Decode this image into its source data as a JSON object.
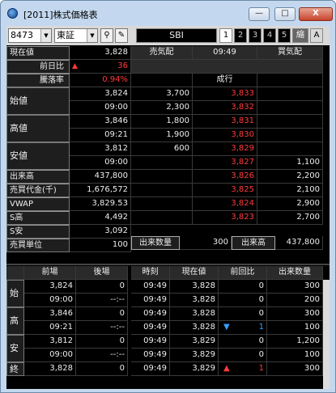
{
  "window": {
    "title": "[2011]株式価格表",
    "minimize": "—",
    "maximize": "□",
    "close": "X"
  },
  "toolbar": {
    "code": "8473",
    "market": "東証",
    "broker": "SBI",
    "tabs": [
      "1",
      "2",
      "3",
      "4",
      "5"
    ],
    "shuku": "縮",
    "a": "A"
  },
  "top_header": {
    "sell": "売気配",
    "time": "09:49",
    "buy": "買気配"
  },
  "left": {
    "genzai": {
      "label": "現在値",
      "value": "3,828"
    },
    "zenjitsu": {
      "label": "前日比",
      "value": "36"
    },
    "toraku": {
      "label": "騰落率",
      "value": "0.94%"
    },
    "hajime": {
      "label": "始値",
      "v1": "3,824",
      "v2": "09:00"
    },
    "takane": {
      "label": "高値",
      "v1": "3,846",
      "v2": "09:21"
    },
    "yasune": {
      "label": "安値",
      "v1": "3,812",
      "v2": "09:00"
    },
    "dekidaka": {
      "label": "出来高",
      "value": "437,800"
    },
    "baibai": {
      "label": "売買代金(千)",
      "value": "1,676,572"
    },
    "vwap": {
      "label": "VWAP",
      "value": "3,829.53"
    },
    "sdaka": {
      "label": "S高",
      "value": "4,492"
    },
    "syasu": {
      "label": "S安",
      "value": "3,092"
    },
    "tani": {
      "label": "売買単位",
      "value": "100"
    }
  },
  "board": [
    {
      "sell": "",
      "price": "成行",
      "buy": ""
    },
    {
      "sell": "3,700",
      "price": "3,833",
      "buy": ""
    },
    {
      "sell": "2,300",
      "price": "3,832",
      "buy": ""
    },
    {
      "sell": "1,800",
      "price": "3,831",
      "buy": ""
    },
    {
      "sell": "1,900",
      "price": "3,830",
      "buy": ""
    },
    {
      "sell": "600",
      "price": "3,829",
      "buy": ""
    },
    {
      "sell": "",
      "price": "3,827",
      "buy": "1,100"
    },
    {
      "sell": "",
      "price": "3,826",
      "buy": "2,200"
    },
    {
      "sell": "",
      "price": "3,825",
      "buy": "2,100"
    },
    {
      "sell": "",
      "price": "3,824",
      "buy": "2,900"
    },
    {
      "sell": "",
      "price": "3,823",
      "buy": "2,700"
    }
  ],
  "volume_row": {
    "label1": "出来数量",
    "v1": "300",
    "label2": "出来高",
    "v2": "437,800"
  },
  "lower_header": {
    "zenba": "前場",
    "goba": "後場",
    "jikoku": "時刻",
    "genzai": "現在値",
    "zenkai": "前回比",
    "dekisu": "出来数量"
  },
  "session": [
    {
      "label": "始",
      "r1": [
        "3,824",
        "0"
      ],
      "r2": [
        "09:00",
        "--:--"
      ]
    },
    {
      "label": "高",
      "r1": [
        "3,846",
        "0"
      ],
      "r2": [
        "09:21",
        "--:--"
      ]
    },
    {
      "label": "安",
      "r1": [
        "3,812",
        "0"
      ],
      "r2": [
        "09:00",
        "--:--"
      ]
    },
    {
      "label": "終",
      "r1": [
        "3,828",
        "0"
      ]
    }
  ],
  "ticks": [
    {
      "time": "09:49",
      "price": "3,828",
      "mark": "",
      "diff": "0",
      "vol": "300"
    },
    {
      "time": "09:49",
      "price": "3,828",
      "mark": "",
      "diff": "0",
      "vol": "200"
    },
    {
      "time": "09:49",
      "price": "3,828",
      "mark": "",
      "diff": "0",
      "vol": "300"
    },
    {
      "time": "09:49",
      "price": "3,828",
      "mark": "▼",
      "diff": "1",
      "vol": "100"
    },
    {
      "time": "09:49",
      "price": "3,829",
      "mark": "",
      "diff": "0",
      "vol": "1,200"
    },
    {
      "time": "09:49",
      "price": "3,829",
      "mark": "",
      "diff": "0",
      "vol": "100"
    },
    {
      "time": "09:49",
      "price": "3,829",
      "mark": "▲",
      "diff": "1",
      "vol": "300"
    }
  ],
  "colors": {
    "up": "#ff3b3b",
    "down": "#37a0ff"
  }
}
